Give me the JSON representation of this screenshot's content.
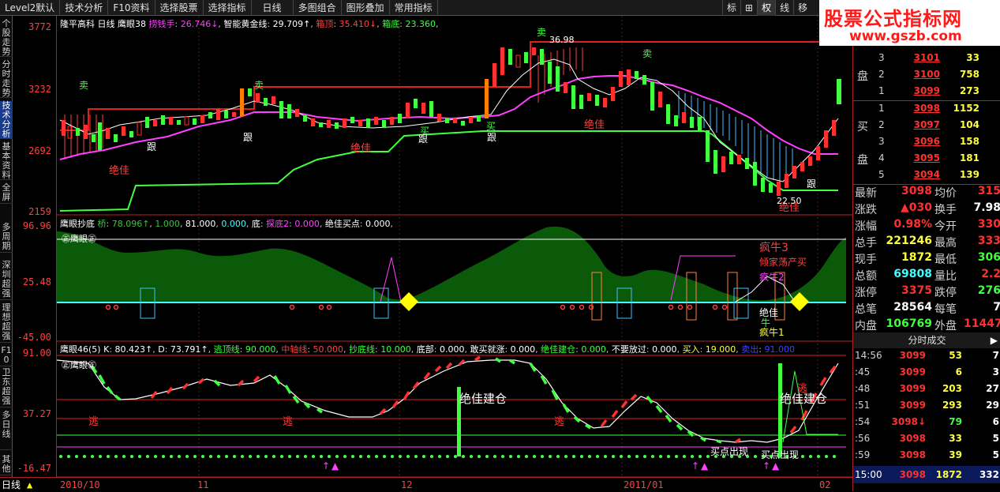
{
  "toolbar": {
    "items": [
      "Level2默认",
      "技术分析",
      "F10资料",
      "选择股票",
      "选择指标",
      "日线",
      "多图组合",
      "图形叠加",
      "常用指标"
    ],
    "right_items": [
      "标",
      "⊞",
      "权",
      "线",
      "移"
    ]
  },
  "logo": {
    "line1": "股票公式指标网",
    "line2": "www.gszb.com"
  },
  "sidebar": {
    "items": [
      "个股走势",
      "分时走势",
      "技术分析",
      "基本资料",
      "全屏",
      "多周期",
      "深圳超强",
      "理想超强",
      "F10",
      "卫东超强",
      "多日线",
      "其他"
    ],
    "active": 2
  },
  "yaxis": {
    "p1": [
      "3772",
      "3232",
      "2692",
      "2159"
    ],
    "p2": [
      "96.96",
      "25.48",
      "-45.00"
    ],
    "p3": [
      "91.00",
      "37.27",
      "-16.47"
    ]
  },
  "panel1": {
    "title": "隆平高科",
    "period": "日线",
    "ind": "鹰眼38",
    "labels": [
      {
        "k": "捞钱手",
        "v": "26.746↓",
        "c": "#ff40ff"
      },
      {
        "k": "智能黄金线",
        "v": "29.709↑",
        "c": "#ffffff"
      },
      {
        "k": "箱顶",
        "v": "35.410↓",
        "c": "#ff4040"
      },
      {
        "k": "箱底",
        "v": "23.360",
        "c": "#40ff40"
      }
    ],
    "annotations": [
      "卖",
      "卖",
      "卖",
      "卖",
      "跟",
      "跟",
      "跟",
      "跟",
      "跟",
      "买",
      "买",
      "绝佳",
      "绝佳",
      "绝佳",
      "绝佳"
    ],
    "peak": "36.98",
    "trough": "22.50"
  },
  "panel2": {
    "title": "鹰眼抄底",
    "labels": [
      {
        "k": "桥",
        "v": "78.096↑",
        "c": "#40c040"
      },
      {
        "k": "",
        "v": "1.000",
        "c": "#40c040"
      },
      {
        "k": "",
        "v": "81.000",
        "c": "#ffffff"
      },
      {
        "k": "",
        "v": "0.000",
        "c": "#40ffff"
      },
      {
        "k": "底",
        "v": "",
        "c": "#ffffff"
      },
      {
        "k": "探底2",
        "v": "0.000",
        "c": "#ff40ff"
      },
      {
        "k": "绝佳买点",
        "v": "0.000",
        "c": "#ffffff"
      }
    ],
    "marker": "㊣鹰眼㊣",
    "tags": [
      "疯牛3",
      "倾家荡产买",
      "疯牛2",
      "绝佳",
      "牛",
      "疯牛1"
    ]
  },
  "panel3": {
    "title": "鹰眼46(5)",
    "labels": [
      {
        "k": "K",
        "v": "80.423↑",
        "c": "#ffffff"
      },
      {
        "k": "D",
        "v": "73.791↑",
        "c": "#ffffff"
      },
      {
        "k": "逃顶线",
        "v": "90.000",
        "c": "#40ff40"
      },
      {
        "k": "中轴线",
        "v": "50.000",
        "c": "#ff4040"
      },
      {
        "k": "抄底线",
        "v": "10.000",
        "c": "#40ff40"
      },
      {
        "k": "底部",
        "v": "0.000",
        "c": "#ffffff"
      },
      {
        "k": "敢买就涨",
        "v": "0.000",
        "c": "#ffffff"
      },
      {
        "k": "绝佳建仓",
        "v": "0.000",
        "c": "#40ff40"
      },
      {
        "k": "不要放过",
        "v": "0.000",
        "c": "#ffffff"
      },
      {
        "k": "买入",
        "v": "19.000",
        "c": "#ffff40"
      },
      {
        "k": "卖出",
        "v": "91.000",
        "c": "#4040ff"
      }
    ],
    "marker": "㊣鹰眼㊣",
    "tags": [
      "逃",
      "逃",
      "逃",
      "绝佳建仓",
      "绝佳建仓",
      "买点出现",
      "买点出现",
      "逃"
    ]
  },
  "dates": [
    "2010/10",
    "11",
    "12",
    "2011/01",
    "02"
  ],
  "bottom": {
    "label": "日线"
  },
  "orderbook": {
    "sell_label": "盘",
    "buy_label1": "买",
    "buy_label2": "盘",
    "asks": [
      {
        "i": "3",
        "p": "3101",
        "v": "33"
      },
      {
        "i": "2",
        "p": "3100",
        "v": "758"
      },
      {
        "i": "1",
        "p": "3099",
        "v": "273"
      }
    ],
    "bids": [
      {
        "i": "1",
        "p": "3098",
        "v": "1152"
      },
      {
        "i": "2",
        "p": "3097",
        "v": "104"
      },
      {
        "i": "3",
        "p": "3096",
        "v": "158"
      },
      {
        "i": "4",
        "p": "3095",
        "v": "181"
      },
      {
        "i": "5",
        "p": "3094",
        "v": "139"
      }
    ]
  },
  "stats": [
    {
      "l": "最新",
      "v": "3098",
      "c": "#ff3030",
      "l2": "均价",
      "v2": "315",
      "c2": "#ff3030"
    },
    {
      "l": "涨跌",
      "v": "▲030",
      "c": "#ff3030",
      "l2": "换手",
      "v2": "7.98",
      "c2": "#ffffff"
    },
    {
      "l": "涨幅",
      "v": "0.98%",
      "c": "#ff3030",
      "l2": "今开",
      "v2": "330",
      "c2": "#ff3030"
    },
    {
      "l": "总手",
      "v": "221246",
      "c": "#ffff40",
      "l2": "最高",
      "v2": "333",
      "c2": "#ff3030"
    },
    {
      "l": "现手",
      "v": "1872",
      "c": "#ffff40",
      "l2": "最低",
      "v2": "306",
      "c2": "#40ff40"
    },
    {
      "l": "总额",
      "v": "69808",
      "c": "#40ffff",
      "l2": "量比",
      "v2": "2.2",
      "c2": "#ff3030"
    },
    {
      "l": "涨停",
      "v": "3375",
      "c": "#ff3030",
      "l2": "跌停",
      "v2": "276",
      "c2": "#40ff40"
    },
    {
      "l": "总笔",
      "v": "28564",
      "c": "#ffffff",
      "l2": "每笔",
      "v2": "7",
      "c2": "#ffffff"
    },
    {
      "l": "内盘",
      "v": "106769",
      "c": "#40ff40",
      "l2": "外盘",
      "v2": "11447",
      "c2": "#ff3030"
    }
  ],
  "trades": {
    "header": "分时成交",
    "rows": [
      {
        "t": "14:56",
        "p": "3099",
        "v": "53",
        "c": "7"
      },
      {
        "t": ":45",
        "p": "3099",
        "v": "6",
        "c": "3"
      },
      {
        "t": ":48",
        "p": "3099",
        "v": "203",
        "c": "27"
      },
      {
        "t": ":51",
        "p": "3099",
        "v": "293",
        "c": "29"
      },
      {
        "t": ":54",
        "p": "3098↓",
        "v": "79",
        "c": "6"
      },
      {
        "t": ":56",
        "p": "3098",
        "v": "33",
        "c": "5"
      },
      {
        "t": ":59",
        "p": "3098",
        "v": "39",
        "c": "5"
      }
    ],
    "last": {
      "t": "15:00",
      "p": "3098",
      "v": "1872",
      "c": "332"
    }
  }
}
